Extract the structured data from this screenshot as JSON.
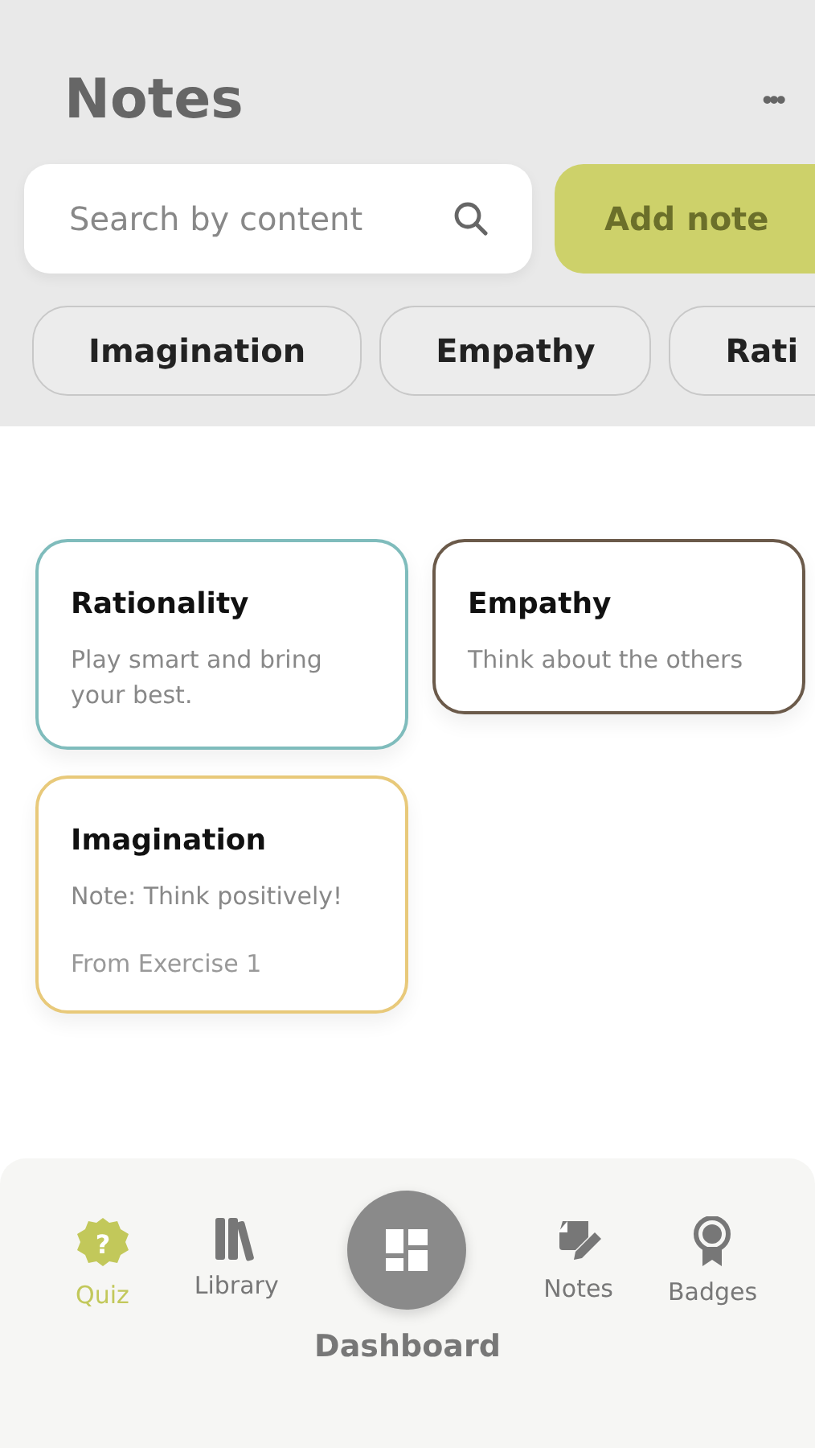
{
  "header": {
    "title": "Notes",
    "menu": "•••"
  },
  "search": {
    "placeholder": "Search by content"
  },
  "add_button": {
    "label": "Add note"
  },
  "filters": [
    {
      "label": "Imagination"
    },
    {
      "label": "Empathy"
    },
    {
      "label": "Rati"
    }
  ],
  "cards": [
    {
      "title": "Rationality",
      "text": "Play smart and bring your best.",
      "color": "#7fbcbc"
    },
    {
      "title": "Empathy",
      "text": "Think about the others",
      "color": "#6b5a4a"
    },
    {
      "title": "Imagination",
      "text": "Note: Think positively!",
      "footer": "From Exercise 1",
      "color": "#e8c97a"
    }
  ],
  "nav": [
    {
      "label": "Quiz",
      "selected": true,
      "glyph": "?"
    },
    {
      "label": "Library",
      "selected": false
    },
    {
      "label": "Dashboard",
      "selected": false
    },
    {
      "label": "Notes",
      "selected": false
    },
    {
      "label": "Badges",
      "selected": false
    }
  ]
}
